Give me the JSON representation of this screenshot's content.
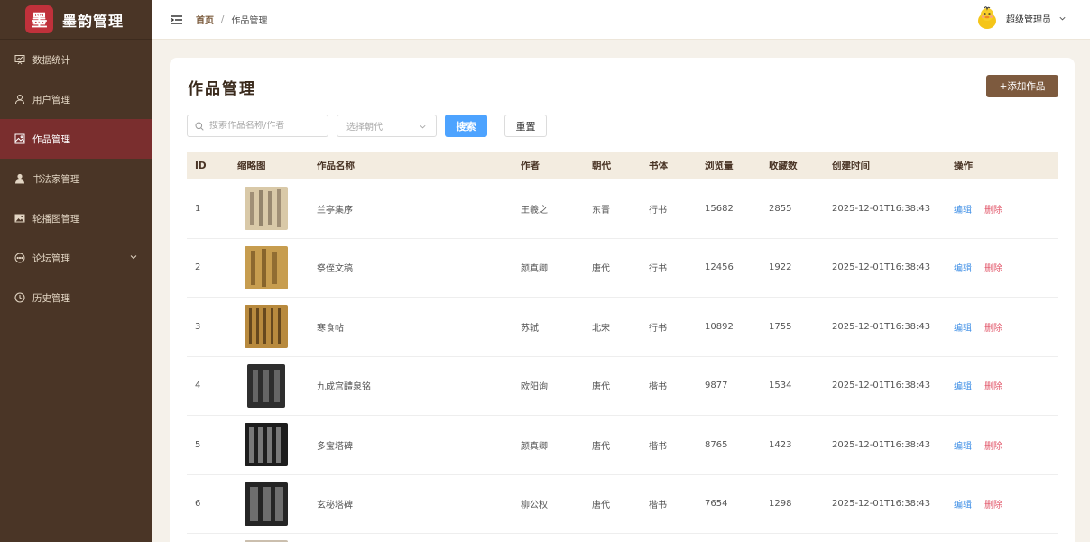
{
  "app": {
    "logo_char": "墨",
    "title": "墨韵管理"
  },
  "sidebar": {
    "items": [
      {
        "label": "数据统计",
        "icon": "chart-board-icon"
      },
      {
        "label": "用户管理",
        "icon": "user-icon"
      },
      {
        "label": "作品管理",
        "icon": "image-icon",
        "active": true
      },
      {
        "label": "书法家管理",
        "icon": "person-filled-icon"
      },
      {
        "label": "轮播图管理",
        "icon": "picture-filled-icon"
      },
      {
        "label": "论坛管理",
        "icon": "chat-icon",
        "has_submenu": true
      },
      {
        "label": "历史管理",
        "icon": "clock-icon"
      }
    ]
  },
  "header": {
    "breadcrumb_home": "首页",
    "breadcrumb_sep": "/",
    "breadcrumb_current": "作品管理",
    "user_name": "超级管理员"
  },
  "page": {
    "title": "作品管理",
    "add_button": "+添加作品",
    "search_placeholder": "搜索作品名称/作者",
    "dynasty_placeholder": "选择朝代",
    "search_button": "搜索",
    "reset_button": "重置"
  },
  "table": {
    "headers": {
      "id": "ID",
      "thumb": "缩略图",
      "name": "作品名称",
      "author": "作者",
      "dynasty": "朝代",
      "style": "书体",
      "views": "浏览量",
      "favorites": "收藏数",
      "created": "创建时间",
      "ops": "操作"
    },
    "edit_label": "编辑",
    "delete_label": "删除",
    "rows": [
      {
        "id": "1",
        "name": "兰亭集序",
        "author": "王羲之",
        "dynasty": "东晋",
        "style": "行书",
        "views": "15682",
        "favorites": "2855",
        "created": "2025-12-01T16:38:43",
        "thumb": "light"
      },
      {
        "id": "2",
        "name": "祭侄文稿",
        "author": "颜真卿",
        "dynasty": "唐代",
        "style": "行书",
        "views": "12456",
        "favorites": "1922",
        "created": "2025-12-01T16:38:43",
        "thumb": "gold"
      },
      {
        "id": "3",
        "name": "寒食帖",
        "author": "苏轼",
        "dynasty": "北宋",
        "style": "行书",
        "views": "10892",
        "favorites": "1755",
        "created": "2025-12-01T16:38:43",
        "thumb": "gold"
      },
      {
        "id": "4",
        "name": "九成宫醴泉铭",
        "author": "欧阳询",
        "dynasty": "唐代",
        "style": "楷书",
        "views": "9877",
        "favorites": "1534",
        "created": "2025-12-01T16:38:43",
        "thumb": "grey"
      },
      {
        "id": "5",
        "name": "多宝塔碑",
        "author": "颜真卿",
        "dynasty": "唐代",
        "style": "楷书",
        "views": "8765",
        "favorites": "1423",
        "created": "2025-12-01T16:38:43",
        "thumb": "dark"
      },
      {
        "id": "6",
        "name": "玄秘塔碑",
        "author": "柳公权",
        "dynasty": "唐代",
        "style": "楷书",
        "views": "7654",
        "favorites": "1298",
        "created": "2025-12-01T16:38:43",
        "thumb": "dark"
      }
    ]
  }
}
